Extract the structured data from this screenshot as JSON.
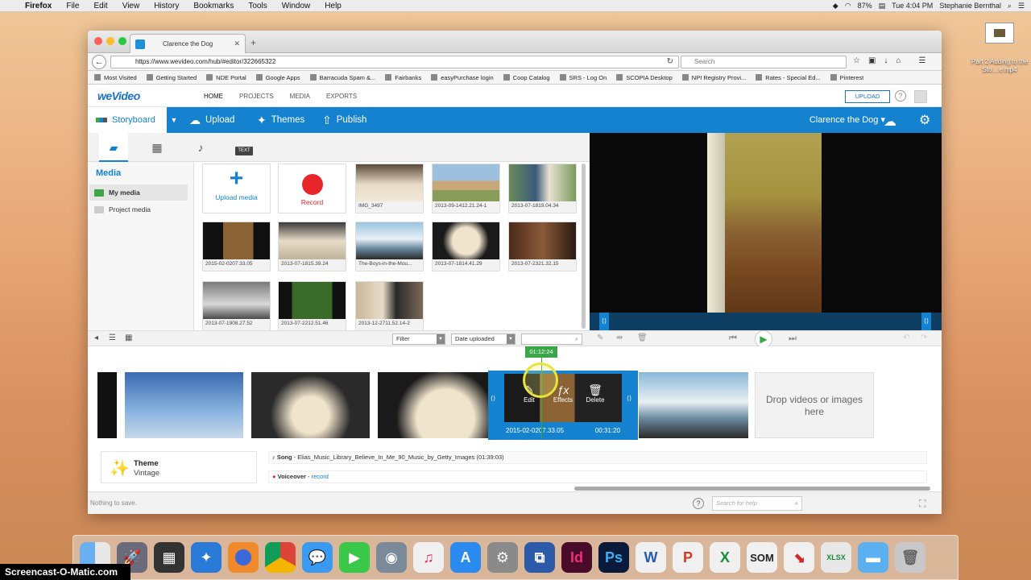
{
  "menubar": {
    "app": "Firefox",
    "items": [
      "File",
      "Edit",
      "View",
      "History",
      "Bookmarks",
      "Tools",
      "Window",
      "Help"
    ],
    "battery": "87%",
    "clock": "Tue 4:04 PM",
    "user": "Stephanie Bernthal"
  },
  "desktop_file": {
    "label": "Part 2 Adding to the Sto....e.mp4"
  },
  "browser": {
    "tab_title": "Clarence the Dog",
    "new_tab": "+",
    "url": "https://www.wevideo.com/hub/#editor/322665322",
    "search_placeholder": "Search",
    "bookmarks": [
      "Most Visited",
      "Getting Started",
      "NDE Portal",
      "Google Apps",
      "Barracuda Spam &...",
      "Fairbanks",
      "easyPurchase login",
      "Coop Catalog",
      "SRS - Log On",
      "SCOPIA Desktop",
      "NPI Registry Provi...",
      "Rates - Special Ed...",
      "Pinterest"
    ]
  },
  "wevideo": {
    "logo": "weVideo",
    "nav": [
      "HOME",
      "PROJECTS",
      "MEDIA",
      "EXPORTS"
    ],
    "upload_button": "UPLOAD",
    "help": "?",
    "toolbar": {
      "storyboard": "Storyboard",
      "upload": "Upload",
      "themes": "Themes",
      "publish": "Publish",
      "project_name": "Clarence the Dog ▾"
    },
    "media": {
      "title": "Media",
      "sidebar": [
        "My media",
        "Project media"
      ],
      "text_tab": "TEXT",
      "upload_media": "Upload media",
      "record": "Record",
      "tiles": [
        "IMG_3497",
        "2013-09-1412.21.24-1",
        "2013-07-1819.04.34",
        "2015-02-0207.33.05",
        "2013-07-1815.39.24",
        "The-Boys-in-the-Mou...",
        "2013-07-1814.41.29",
        "2013-07-2321.32.15",
        "2013-07-1908.27.52",
        "2013-07-2212.51.46",
        "2013-12-2711.52.14-2"
      ]
    },
    "controls": {
      "filter": "Filter",
      "sort": "Date uploaded"
    },
    "timeline": {
      "playhead_time": "01:12:24",
      "selected_clip_name": "2015-02-0207.33.05",
      "selected_clip_duration": "00:31:20",
      "edit": "Edit",
      "effects": "Effects",
      "delete": "Delete",
      "drop_zone": "Drop videos or images here",
      "theme_label": "Theme",
      "theme_value": "Vintage",
      "song_label": "Song",
      "song_value": "- Elias_Music_Library_Believe_In_Me_90_Music_by_Getty_Images (01:39:03)",
      "voiceover_label": "Voiceover",
      "voiceover_action": "record"
    },
    "footer": {
      "status": "Nothing to save.",
      "help_placeholder": "Search for help"
    }
  },
  "watermark": "Screencast-O-Matic.com",
  "colors": {
    "accent": "#1582d0",
    "green": "#3aa648",
    "record_red": "#e8262a"
  }
}
